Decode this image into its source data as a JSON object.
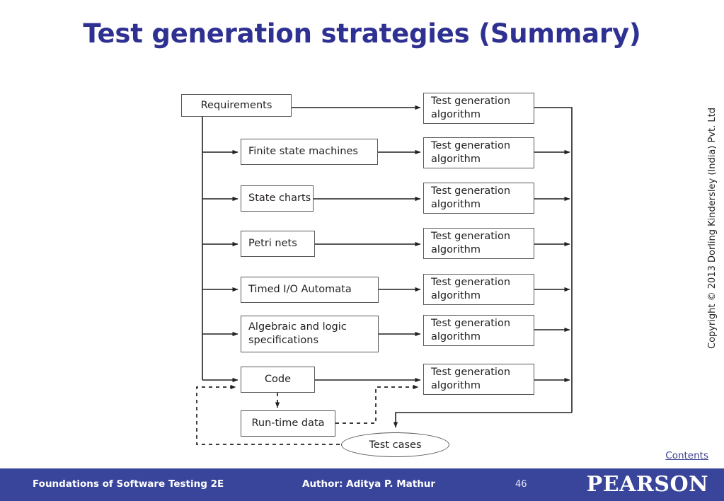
{
  "slide": {
    "title": "Test generation strategies (Summary)",
    "page_number": "46",
    "contents_link": "Contents",
    "copyright": "Copyright © 2013 Dorling Kindersley (India) Pvt. Ltd",
    "title_color": "#2f3192",
    "footer_color": "#38459a"
  },
  "footer": {
    "book": "Foundations of Software Testing 2E",
    "author": "Author: Aditya P. Mathur",
    "brand": "PEARSON"
  },
  "diagram": {
    "source_node": "Requirements",
    "models": [
      "Finite state machines",
      "State charts",
      "Petri nets",
      "Timed I/O Automata",
      "Algebraic and logic\nspecifications",
      "Code"
    ],
    "algorithm_label": "Test generation\nalgorithm",
    "algorithm_count": 7,
    "runtime_node": "Run-time data",
    "output_node": "Test cases"
  }
}
